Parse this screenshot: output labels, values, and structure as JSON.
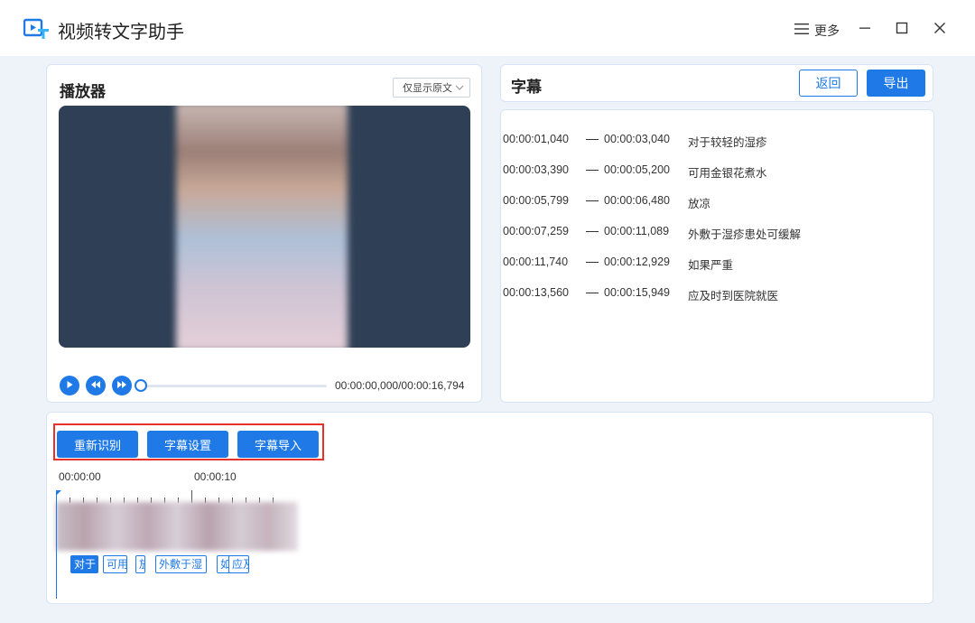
{
  "app": {
    "title": "视频转文字助手",
    "more_label": "更多"
  },
  "player": {
    "title": "播放器",
    "view_mode": "仅显示原文",
    "time_readout": "00:00:00,000/00:00:16,794",
    "progress": 0
  },
  "subtitles": {
    "title": "字幕",
    "back_label": "返回",
    "export_label": "导出",
    "rows": [
      {
        "start": "00:00:01,040",
        "end": "00:00:03,040",
        "text": "对于较轻的湿疹"
      },
      {
        "start": "00:00:03,390",
        "end": "00:00:05,200",
        "text": "可用金银花煮水"
      },
      {
        "start": "00:00:05,799",
        "end": "00:00:06,480",
        "text": "放凉"
      },
      {
        "start": "00:00:07,259",
        "end": "00:00:11,089",
        "text": "外敷于湿疹患处可缓解"
      },
      {
        "start": "00:00:11,740",
        "end": "00:00:12,929",
        "text": "如果严重"
      },
      {
        "start": "00:00:13,560",
        "end": "00:00:15,949",
        "text": "应及时到医院就医"
      }
    ]
  },
  "timeline": {
    "buttons": [
      "重新识别",
      "字幕设置",
      "字幕导入"
    ],
    "labels": [
      "00:00:00",
      "00:00:10"
    ],
    "chips": [
      "对于",
      "可用",
      "放",
      "外敷于湿",
      "如",
      "应及时"
    ]
  },
  "colors": {
    "accent": "#1f7ae8",
    "highlight": "#e8312d",
    "video_bg": "#2f3f55"
  }
}
